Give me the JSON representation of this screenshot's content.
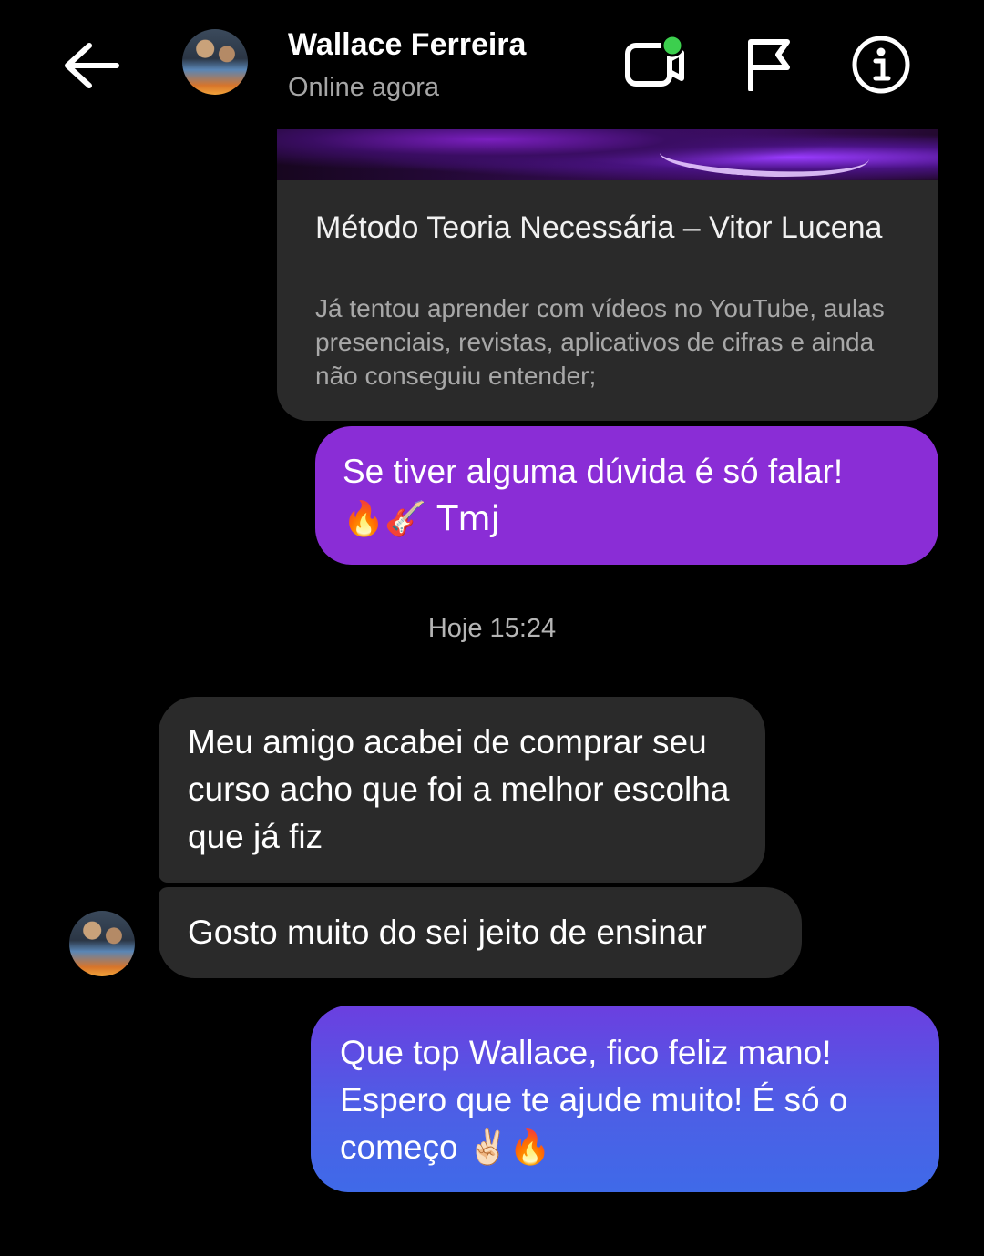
{
  "header": {
    "name": "Wallace Ferreira",
    "status": "Online agora",
    "icons": [
      "back-arrow-icon",
      "video-call-icon",
      "flag-icon",
      "info-icon"
    ],
    "online_dot_color": "#3ccf4e"
  },
  "link_preview": {
    "title": "Método Teoria Necessária – Vitor Lucena",
    "description": "Já tentou aprender com vídeos no YouTube, aulas presenciais, revistas, aplicativos de cifras e ainda não conseguiu entender;"
  },
  "messages": [
    {
      "direction": "out",
      "text": "Se tiver alguma dúvida é só falar!",
      "text2": "🔥🎸 Tmj",
      "color": "#8a2dd6"
    },
    {
      "direction": "in",
      "text": "Meu amigo acabei de comprar seu curso acho que foi a melhor escolha que já fiz"
    },
    {
      "direction": "in",
      "text": "Gosto muito do sei jeito de ensinar"
    },
    {
      "direction": "out",
      "text": "Que top Wallace, fico feliz mano! Espero que te ajude muito! É só o começo ✌🏻🔥"
    }
  ],
  "timestamp": "Hoje 15:24"
}
